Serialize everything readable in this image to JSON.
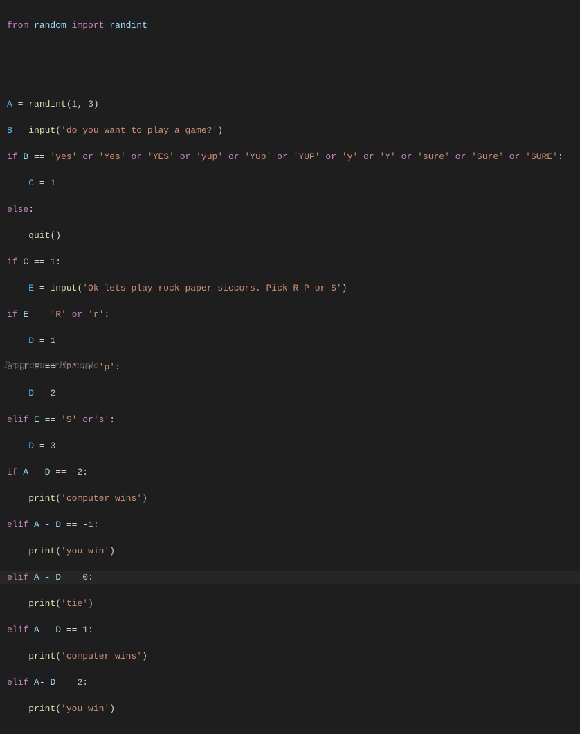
{
  "watermark": "ProgrammerHumor.io",
  "code": {
    "l1_from": "from",
    "l1_random": "random",
    "l1_import": "import",
    "l1_randint": "randint",
    "l2_A": "A",
    "l2_eq": " = ",
    "l2_randint": "randint",
    "l2_p1": "(",
    "l2_n1": "1",
    "l2_c": ", ",
    "l2_n3": "3",
    "l2_p2": ")",
    "l3_B": "B",
    "l3_eq": " = ",
    "l3_input": "input",
    "l3_p1": "(",
    "l3_str": "'do you want to play a game?'",
    "l3_p2": ")",
    "l4_if": "if",
    "l4_B": " B ",
    "l4_eqeq": "== ",
    "l4_s1": "'yes'",
    "l4_or": " or ",
    "l4_s2": "'Yes'",
    "l4_s3": "'YES'",
    "l4_s4": "'yup'",
    "l4_s5": "'Yup'",
    "l4_s6": "'YUP'",
    "l4_s7": "'y'",
    "l4_s8": "'Y'",
    "l4_s9": "'sure'",
    "l4_s10": "'Sure'",
    "l4_s11": "'SURE'",
    "l4_colon": ":",
    "l5_C": "C",
    "l5_eq": " = ",
    "l5_n": "1",
    "l6_else": "else",
    "l6_colon": ":",
    "l7_quit": "quit",
    "l7_par": "()",
    "l8_if": "if",
    "l8_C": " C ",
    "l8_eqeq": "== ",
    "l8_n": "1",
    "l8_colon": ":",
    "l9_E": "E",
    "l9_eq": " = ",
    "l9_input": "input",
    "l9_p1": "(",
    "l9_str": "'Ok lets play rock paper siccors. Pick R P or S'",
    "l9_p2": ")",
    "l10_if": "if",
    "l10_E": " E ",
    "l10_eqeq": "== ",
    "l10_s1": "'R'",
    "l10_or": " or ",
    "l10_s2": "'r'",
    "l10_colon": ":",
    "l11_D": "D",
    "l11_eq": " = ",
    "l11_n": "1",
    "l12_elif": "elif",
    "l12_E": " E ",
    "l12_eqeq": "== ",
    "l12_s1": "'P'",
    "l12_or": " or ",
    "l12_s2": "'p'",
    "l12_colon": ":",
    "l13_D": "D",
    "l13_eq": " = ",
    "l13_n": "2",
    "l14_elif": "elif",
    "l14_E": " E ",
    "l14_eqeq": "== ",
    "l14_s1": "'S'",
    "l14_ors": " or",
    "l14_s2": "'s'",
    "l14_colon": ":",
    "l15_D": "D",
    "l15_eq": " = ",
    "l15_n": "3",
    "l16_if": "if",
    "l16_A": " A ",
    "l16_minus": "- ",
    "l16_D": "D ",
    "l16_eqeq": "== ",
    "l16_n": "-2",
    "l16_colon": ":",
    "l17_print": "print",
    "l17_p1": "(",
    "l17_str": "'computer wins'",
    "l17_p2": ")",
    "l18_elif": "elif",
    "l18_A": " A ",
    "l18_minus": "- ",
    "l18_D": "D ",
    "l18_eqeq": "== ",
    "l18_n": "-1",
    "l18_colon": ":",
    "l19_print": "print",
    "l19_p1": "(",
    "l19_str": "'you win'",
    "l19_p2": ")",
    "l20_elif": "elif",
    "l20_A": " A ",
    "l20_minus": "- ",
    "l20_D": "D ",
    "l20_eqeq": "== ",
    "l20_n": "0",
    "l20_colon": ":",
    "l21_print": "print",
    "l21_p1": "(",
    "l21_str": "'tie'",
    "l21_p2": ")",
    "l22_elif": "elif",
    "l22_A": " A ",
    "l22_minus": "- ",
    "l22_D": "D ",
    "l22_eqeq": "== ",
    "l22_n": "1",
    "l22_colon": ":",
    "l23_print": "print",
    "l23_p1": "(",
    "l23_str": "'computer wins'",
    "l23_p2": ")",
    "l24_elif": "elif",
    "l24_A": " A",
    "l24_minus": "- ",
    "l24_D": "D ",
    "l24_eqeq": "== ",
    "l24_n": "2",
    "l24_colon": ":",
    "l25_print": "print",
    "l25_p1": "(",
    "l25_str": "'you win'",
    "l25_p2": ")"
  }
}
